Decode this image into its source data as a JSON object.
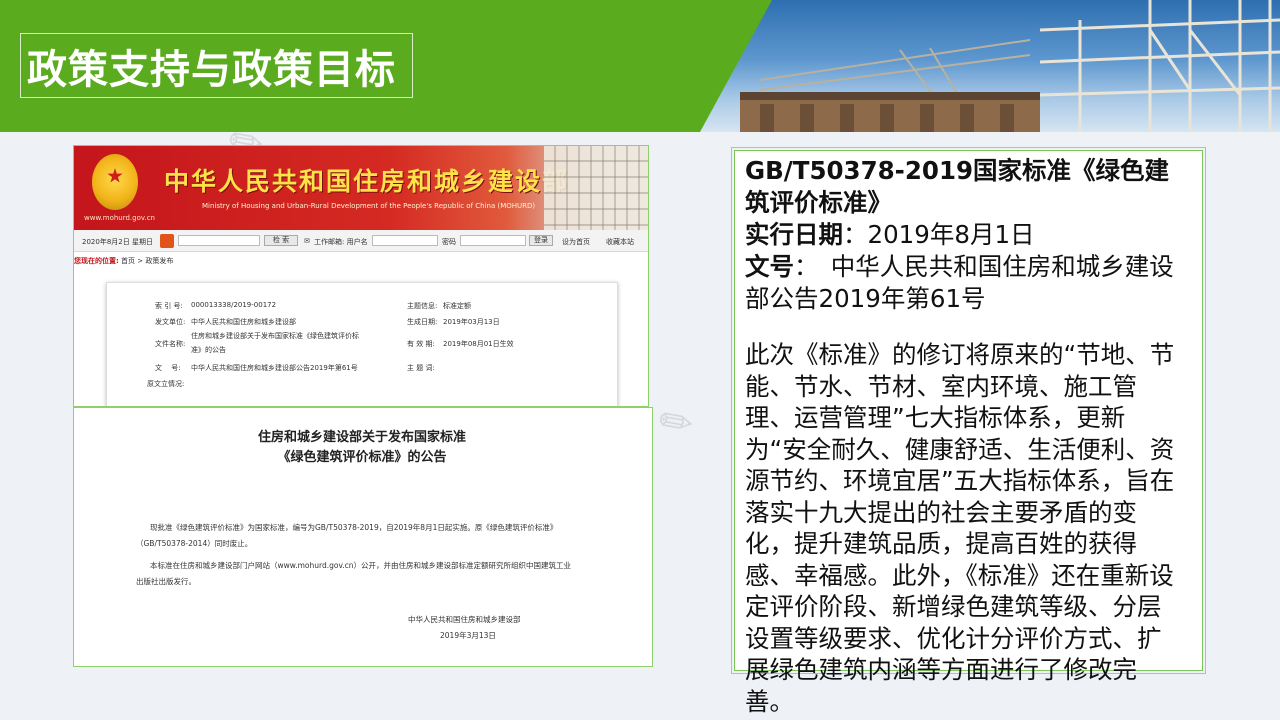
{
  "slide": {
    "title": "政策支持与政策目标"
  },
  "document_image": {
    "banner": {
      "title": "中华人民共和国住房和城乡建设部",
      "subtitle": "Ministry of Housing and Urban-Rural Development of the People's Republic of China (MOHURD)",
      "url": "www.mohurd.gov.cn"
    },
    "toolbar": {
      "date": "2020年8月2日 星期日",
      "search_button": "检 索",
      "mail_label": "工作邮箱: 用户名",
      "password_label": "密码",
      "login_button": "登录",
      "set_home": "设为首页",
      "bookmark": "收藏本站"
    },
    "breadcrumb": {
      "label": "您现在的位置:",
      "path": "首页 > 政策发布"
    },
    "info": {
      "index_label": "索 引 号:",
      "index_value": "000013338/2019-00172",
      "subject_label": "主题信息:",
      "subject_value": "标准定额",
      "issuer_label": "发文单位:",
      "issuer_value": "中华人民共和国住房和城乡建设部",
      "created_label": "生成日期:",
      "created_value": "2019年03月13日",
      "filename_label": "文件名称:",
      "filename_value_1": "住房和城乡建设部关于发布国家标准《绿色建筑评价标",
      "filename_value_2": "准》的公告",
      "valid_label": "有 效 期:",
      "valid_value": "2019年08月01日生效",
      "docno_label": "文　 号:",
      "docno_value": "中华人民共和国住房和城乡建设部公告2019年第61号",
      "keyword_label": "主 题 词:",
      "status_label": "原文立情况:"
    },
    "notice": {
      "title_1": "住房和城乡建设部关于发布国家标准",
      "title_2": "《绿色建筑评价标准》的公告",
      "para1_1": "现批准《绿色建筑评价标准》为国家标准，编号为GB/T50378-2019，自2019年8月1日起实施。原《绿色建筑评价标准》",
      "para1_2": "（GB/T50378-2014）同时废止。",
      "para2_1": "本标准在住房和城乡建设部门户网站（www.mohurd.gov.cn）公开，并由住房和城乡建设部标准定额研究所组织中国建筑工业",
      "para2_2": "出版社出版发行。",
      "signature": "中华人民共和国住房和城乡建设部",
      "date": "2019年3月13日"
    }
  },
  "text_panel": {
    "heading": "GB/T50378-2019国家标准《绿色建筑评价标准》",
    "date_label": "实行日期",
    "date_value": "：2019年8月1日",
    "docno_label": "文号",
    "docno_value": "：　中华人民共和国住房和城乡建设部公告2019年第61号",
    "body": "此次《标准》的修订将原来的“节地、节能、节水、节材、室内环境、施工管理、运营管理”七大指标体系，更新为“安全耐久、健康舒适、生活便利、资源节约、环境宜居”五大指标体系，旨在落实十九大提出的社会主要矛盾的变化，提升建筑品质，提高百姓的获得感、幸福感。此外，《标准》还在重新设定评价阶段、新增绿色建筑等级、分层设置等级要求、优化计分评价方式、扩展绿色建筑内涵等方面进行了修改完善。"
  }
}
